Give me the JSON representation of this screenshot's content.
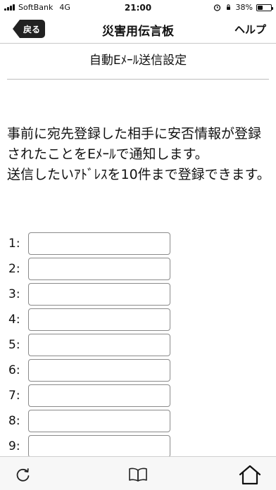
{
  "status_bar": {
    "carrier": "SoftBank",
    "network": "4G",
    "time": "21:00",
    "battery_percent_text": "38%",
    "battery_level": 0.38,
    "icons": [
      "signal-icon",
      "alarm-icon",
      "orientation-lock-icon",
      "battery-icon"
    ]
  },
  "nav": {
    "back_label": "戻る",
    "title": "災害用伝言板",
    "help_label": "ヘルプ"
  },
  "section": {
    "title": "自動Eﾒｰﾙ送信設定"
  },
  "description": {
    "line1": "事前に宛先登録した相手に安否情報が登録されたことをEﾒｰﾙで通知します。",
    "line2": "送信したいｱﾄﾞﾚｽを10件まで登録できます。"
  },
  "fields": [
    {
      "label": "1:",
      "value": ""
    },
    {
      "label": "2:",
      "value": ""
    },
    {
      "label": "3:",
      "value": ""
    },
    {
      "label": "4:",
      "value": ""
    },
    {
      "label": "5:",
      "value": ""
    },
    {
      "label": "6:",
      "value": ""
    },
    {
      "label": "7:",
      "value": ""
    },
    {
      "label": "8:",
      "value": ""
    },
    {
      "label": "9:",
      "value": ""
    }
  ],
  "toolbar": {
    "icons": [
      "reload-icon",
      "book-icon",
      "home-icon"
    ]
  }
}
